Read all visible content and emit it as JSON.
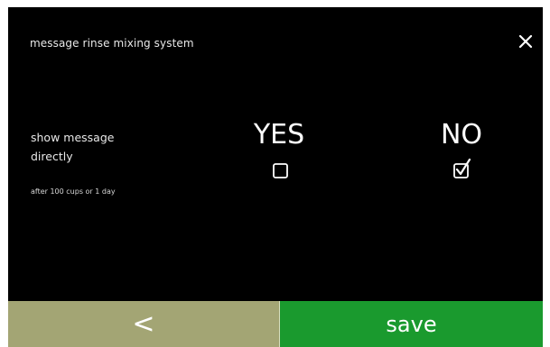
{
  "header": {
    "title": "message rinse mixing system",
    "close_icon": "close-icon"
  },
  "option": {
    "label": "show message directly",
    "sublabel": "after 100 cups or 1 day",
    "choices": [
      {
        "label": "YES",
        "checked": false
      },
      {
        "label": "NO",
        "checked": true
      }
    ]
  },
  "footer": {
    "back_label": "<",
    "save_label": "save"
  },
  "colors": {
    "background": "#000000",
    "back_button": "#a3a574",
    "save_button": "#1a9a2e"
  }
}
